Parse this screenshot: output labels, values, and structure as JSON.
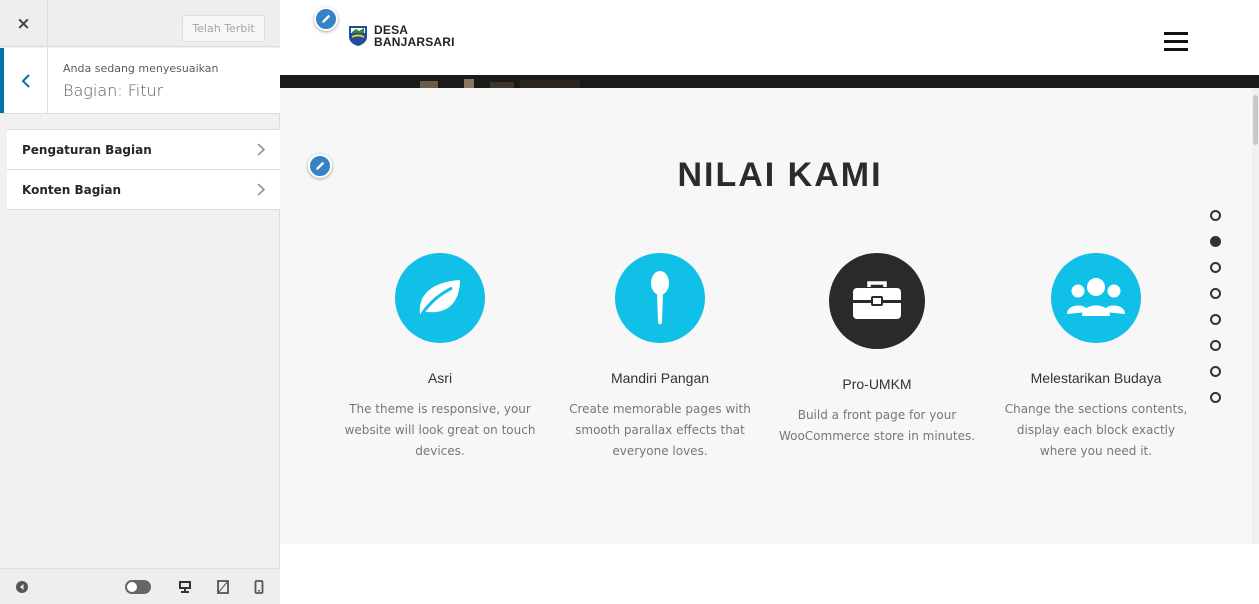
{
  "sidebar": {
    "close_label": "×",
    "publish_label": "Telah Terbit",
    "title_pre": "Anda sedang menyesuaikan",
    "title_main": "Bagian: Fitur",
    "items": [
      {
        "label": "Pengaturan Bagian"
      },
      {
        "label": "Konten Bagian"
      }
    ]
  },
  "site": {
    "logo_line1": "DESA",
    "logo_line2": "BANJARSARI"
  },
  "section": {
    "title": "NILAI KAMI",
    "features": [
      {
        "title": "Asri",
        "desc": "The theme is responsive, your website will look great on touch devices.",
        "icon": "leaf-icon",
        "color": "#10c0e6"
      },
      {
        "title": "Mandiri Pangan",
        "desc": "Create memorable pages with smooth parallax effects that everyone loves.",
        "icon": "spoon-icon",
        "color": "#10c0e6"
      },
      {
        "title": "Pro-UMKM",
        "desc": "Build a front page for your WooCommerce store in minutes.",
        "icon": "briefcase-icon",
        "color": "#2a2a2a"
      },
      {
        "title": "Melestarikan Budaya",
        "desc": "Change the sections contents, display each block exactly where you need it.",
        "icon": "users-icon",
        "color": "#10c0e6"
      }
    ]
  },
  "dots": {
    "count": 8,
    "active_index": 1
  },
  "colors": {
    "accent": "#0073aa",
    "edit_pen": "#3582c4",
    "feature_blue": "#10c0e6",
    "feature_dark": "#2a2a2a"
  }
}
